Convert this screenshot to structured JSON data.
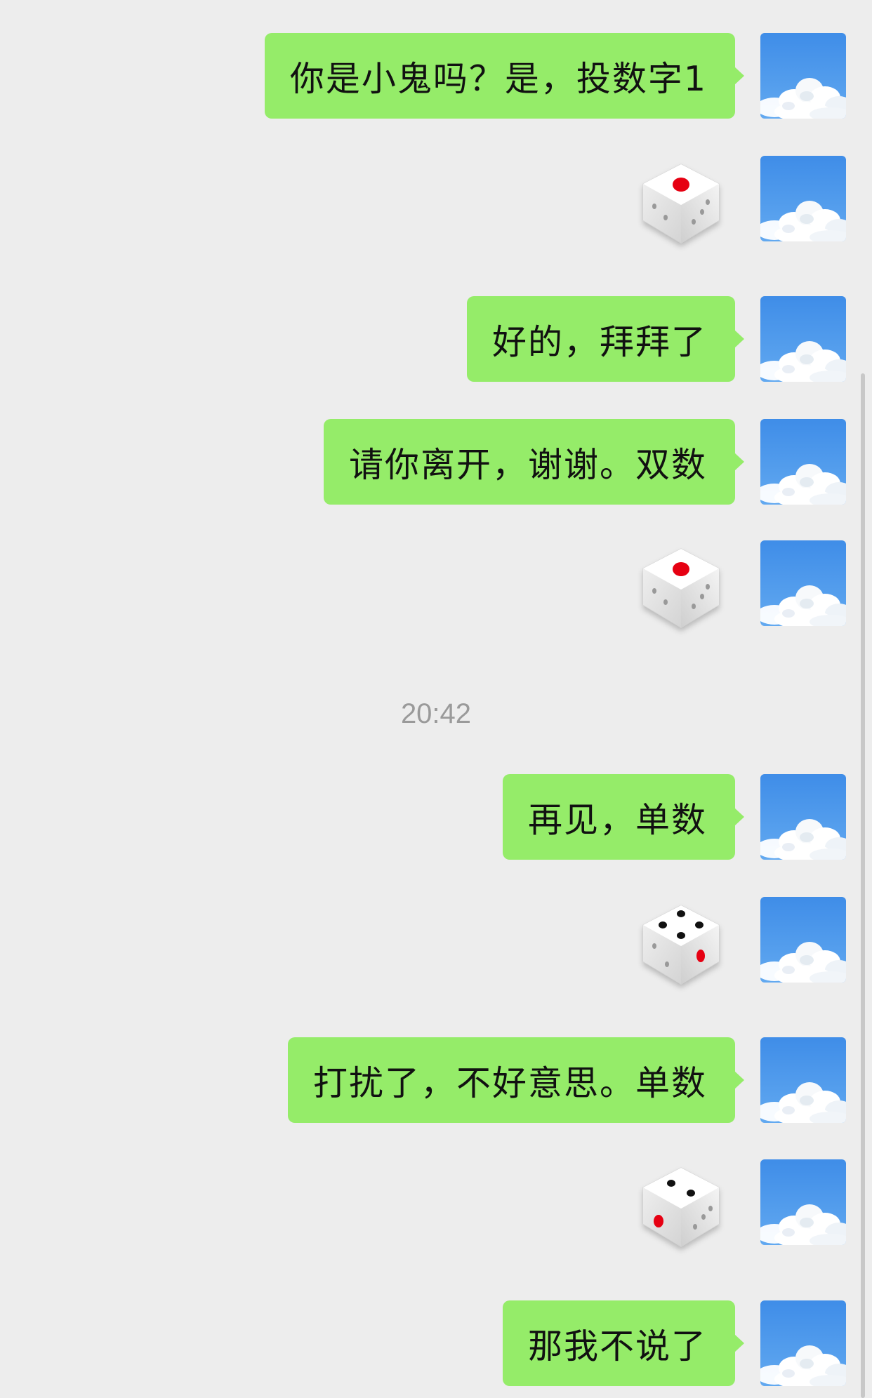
{
  "messages": [
    {
      "type": "text",
      "text": "你是小鬼吗？是，投数字1"
    },
    {
      "type": "dice",
      "face": 1
    },
    {
      "type": "text",
      "text": "好的，拜拜了"
    },
    {
      "type": "text",
      "text": "请你离开，谢谢。双数"
    },
    {
      "type": "dice",
      "face": 1
    },
    {
      "type": "time",
      "text": "20:42"
    },
    {
      "type": "text",
      "text": "再见，单数"
    },
    {
      "type": "dice",
      "face": 4
    },
    {
      "type": "text",
      "text": "打扰了，不好意思。单数"
    },
    {
      "type": "dice",
      "face": 2
    },
    {
      "type": "text",
      "text": "那我不说了"
    }
  ],
  "colors": {
    "background": "#ededed",
    "bubble": "#95ec69",
    "timestamp": "#9a9a9a",
    "dice_red_pip": "#e60012"
  },
  "icons": {
    "avatar": "sky-cloud-avatar",
    "dice": "dice-icon"
  }
}
